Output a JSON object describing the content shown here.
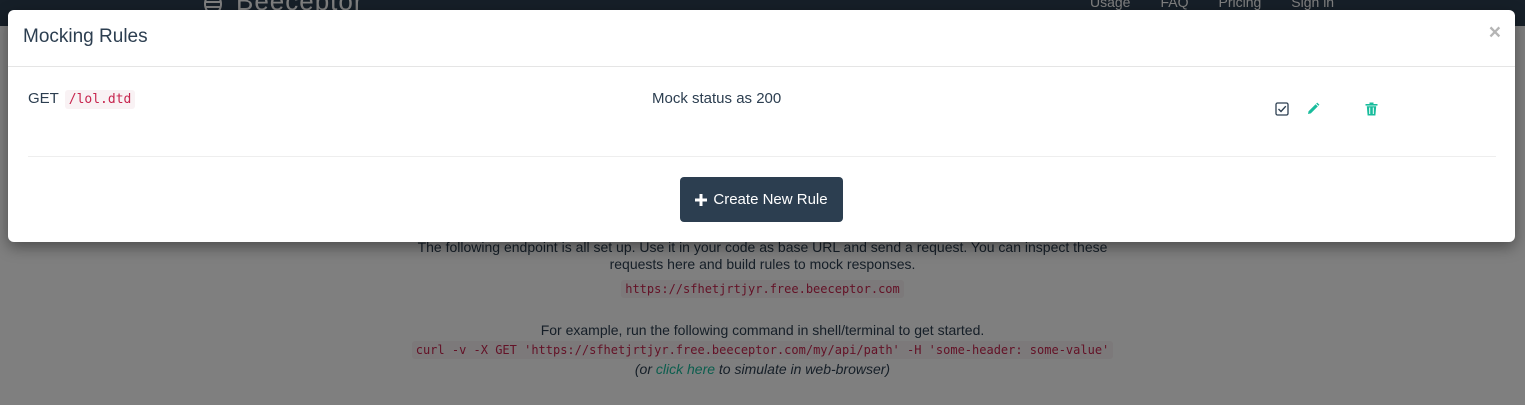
{
  "navbar": {
    "brand": "Beeceptor",
    "links": [
      "Usage",
      "FAQ",
      "Pricing",
      "Sign in"
    ]
  },
  "intro": {
    "line1": "The following endpoint is all set up. Use it in your code as base URL and send a request. You can inspect these requests here and build rules to mock responses.",
    "endpoint": "https://sfhetjrtjyr.free.beeceptor.com",
    "example": "For example, run the following command in shell/terminal to get started.",
    "curl": "curl -v -X GET 'https://sfhetjrtjyr.free.beeceptor.com/my/api/path' -H 'some-header: some-value'",
    "browser_prefix": "(or ",
    "browser_link": "click here",
    "browser_suffix": " to simulate in web-browser)"
  },
  "modal": {
    "title": "Mocking Rules",
    "close": "×",
    "rules": [
      {
        "method": "GET",
        "path": "/lol.dtd",
        "description": "Mock status as 200",
        "enabled": true
      }
    ],
    "create_button": "Create New Rule"
  },
  "colors": {
    "navbar": "#2c3e50",
    "accent": "#18bc9c",
    "code_text": "#c7254e",
    "button": "#2c3e50"
  }
}
